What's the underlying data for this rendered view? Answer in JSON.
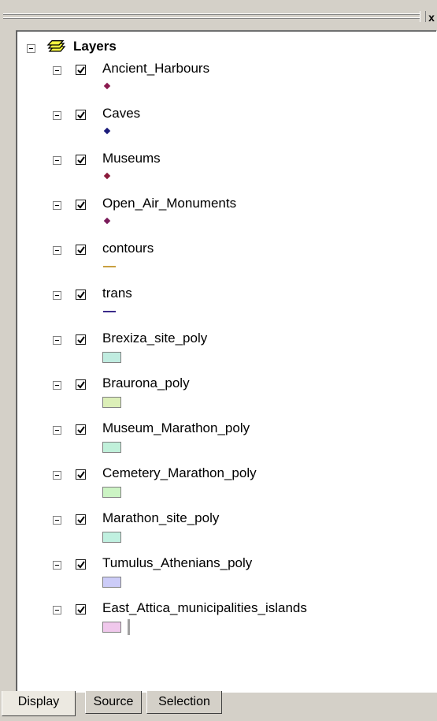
{
  "window": {
    "close_label": "x"
  },
  "tree": {
    "root_label": "Layers",
    "layers": [
      {
        "name": "Ancient_Harbours",
        "checked": true,
        "legend": {
          "kind": "point",
          "color": "#8b1a4f"
        }
      },
      {
        "name": "Caves",
        "checked": true,
        "legend": {
          "kind": "point",
          "color": "#1a1a7a"
        }
      },
      {
        "name": "Museums",
        "checked": true,
        "legend": {
          "kind": "point",
          "color": "#8b1a3a"
        }
      },
      {
        "name": "Open_Air_Monuments",
        "checked": true,
        "legend": {
          "kind": "point",
          "color": "#7a1a5a"
        }
      },
      {
        "name": "contours",
        "checked": true,
        "legend": {
          "kind": "line",
          "color": "#c8a040"
        }
      },
      {
        "name": "trans",
        "checked": true,
        "legend": {
          "kind": "line",
          "color": "#3a2a8a"
        }
      },
      {
        "name": "Brexiza_site_poly",
        "checked": true,
        "legend": {
          "kind": "polygon",
          "color": "#c0ece0"
        }
      },
      {
        "name": "Braurona_poly",
        "checked": true,
        "legend": {
          "kind": "polygon",
          "color": "#dcefb8"
        }
      },
      {
        "name": "Museum_Marathon_poly",
        "checked": true,
        "legend": {
          "kind": "polygon",
          "color": "#c0f0da"
        }
      },
      {
        "name": "Cemetery_Marathon_poly",
        "checked": true,
        "legend": {
          "kind": "polygon",
          "color": "#ccf4c4"
        }
      },
      {
        "name": "Marathon_site_poly",
        "checked": true,
        "legend": {
          "kind": "polygon",
          "color": "#c0f0e0"
        }
      },
      {
        "name": "Tumulus_Athenians_poly",
        "checked": true,
        "legend": {
          "kind": "polygon",
          "color": "#ccccf8"
        }
      },
      {
        "name": "East_Attica_municipalities_islands",
        "checked": true,
        "legend": {
          "kind": "polygon",
          "color": "#f0c8ec"
        }
      }
    ]
  },
  "tabs": [
    {
      "label": "Display",
      "active": true
    },
    {
      "label": "Source",
      "active": false
    },
    {
      "label": "Selection",
      "active": false
    }
  ]
}
